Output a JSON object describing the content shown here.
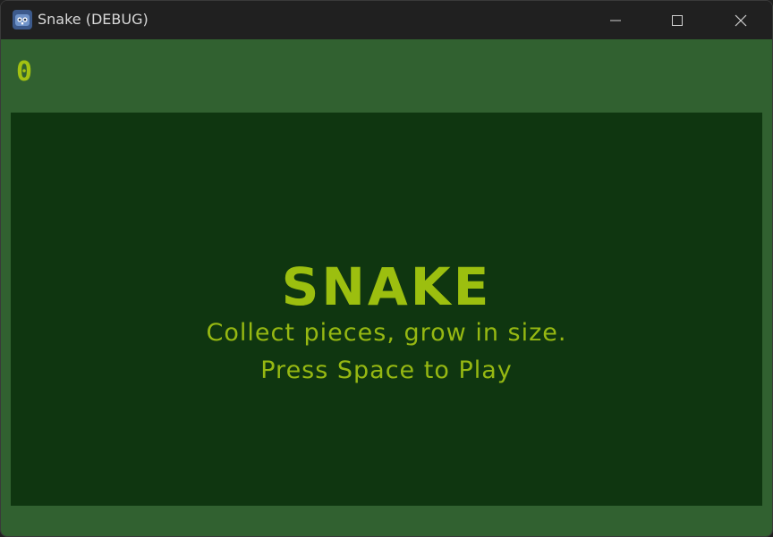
{
  "window": {
    "title": "Snake (DEBUG)",
    "app_icon": "godot-icon",
    "controls": {
      "minimize": "minimize-icon",
      "maximize": "maximize-icon",
      "close": "close-icon"
    }
  },
  "game": {
    "score": "0",
    "title": "SNAKE",
    "tagline": "Collect pieces, grow in size.",
    "prompt": "Press Space to Play"
  },
  "colors": {
    "titlebar": "#202020",
    "game_background": "#316130",
    "playfield": "#0f3610",
    "text_accent": "#9cbf0f"
  }
}
